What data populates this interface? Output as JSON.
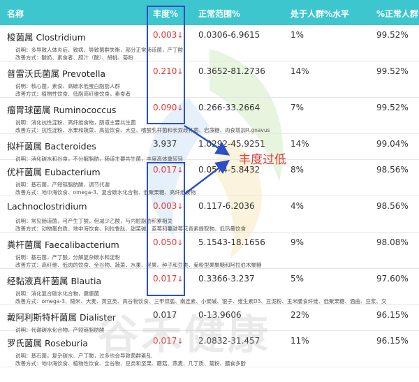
{
  "columns": {
    "name": "名称",
    "abundance": "丰度%",
    "normal_range": "正常范围%",
    "population_level": "处于人群%水平",
    "normal_population": "%正常人群"
  },
  "rows": [
    {
      "name": "梭菌属 Clostridium",
      "abundance": "0.003",
      "low": true,
      "range": "0.0306-6.9615",
      "pct": "1%",
      "norm": "99.52%",
      "desc": "说明：多导致人体炎症、致病，导致菌群失衡，部分正常肠道菌，产丁酸",
      "tips": "改善方式：酸奶、素食者、胆汁（酸）、胡桃、菊粉"
    },
    {
      "name": "普雷沃氏菌属 Prevotella",
      "abundance": "0.210",
      "low": true,
      "range": "0.3652-81.2736",
      "pct": "14%",
      "norm": "99.52%",
      "desc": "说明：核心菌，素食、高碳水低蛋白脂肪人群",
      "tips": "改善方式：植物性饮食、低脂高纤维饮食，素食者"
    },
    {
      "name": "瘤胃球菌属 Ruminococcus",
      "abundance": "0.090",
      "low": true,
      "range": "0.266-33.2664",
      "pct": "7%",
      "norm": "99.52%",
      "desc": "说明：消化抗性淀粉、高纤维食物，肠道主要共生菌",
      "tips": "改善方式：抗性淀粉、水果和蔬菜、高盐饮食、大豆、嗜酸乳杆菌和长双歧杆菌、岩藻糖、肉食增加R.gnavus"
    },
    {
      "name": "拟杆菌属 Bacteroides",
      "abundance": "3.937",
      "low": false,
      "range": "1.0292-45.9251",
      "pct": "14%",
      "norm": "99.04%",
      "desc": "说明：消化碳水和谷食，不分解脂肪，肠道主要共生菌，丰度高体重较轻",
      "tips": ""
    },
    {
      "name": "优杆菌属 Eubacterium",
      "abundance": "0.017",
      "low": true,
      "range": "0.0574-5.8432",
      "pct": "8%",
      "norm": "98.56%",
      "desc": "说明：基石菌，产短链脂肪酸，调节代谢",
      "tips": "改善方式：地中海饮食、omega-3、复合碳水化合物、低聚果糖、高纤维食物"
    },
    {
      "name": "Lachnoclostridium",
      "abundance": "0.003",
      "low": true,
      "range": "0.117-6.2036",
      "pct": "4%",
      "norm": "98.56%",
      "desc": "说明：常见肠道菌，可产生丁酸，但减少乙酸，与内脏脂肪积累相关",
      "tips": "改善方式：动物蛋白质、地中海饮食、利拉鲁肽、甜菜碱、蓝莓和蔓越莓花青素提取物、低热量饮食"
    },
    {
      "name": "粪杆菌属 Faecalibacterium",
      "abundance": "0.050",
      "low": true,
      "range": "5.1543-18.1656",
      "pct": "9%",
      "norm": "98.08%",
      "desc": "说明：基石菌，产丁酸，分解复杂碳水和淀粉",
      "tips": "改善方式：高纤维、低肉的饮食、全谷物、蔬菜、水果、坚果、种子和豆类、菊粉型果聚糖和阿拉伯木聚糖"
    },
    {
      "name": "经黏液真杆菌属 Blautia",
      "abundance": "0.017",
      "low": true,
      "range": "0.3366-3.237",
      "pct": "5%",
      "norm": "97.60%",
      "desc": "说明：消化复合碳水化合物，健康菌",
      "tips": "改善方式：omega-3、糙米、大麦、黄豆类、高谷物饮食、三甲双胍、南连素、小檗碱、银子、维生素D3、豆泥粉、玉米膳食纤维、低聚果糖、酒曲、豆浆、交"
    },
    {
      "name": "戴阿利斯特杆菌属 Dialister",
      "abundance": "0.017",
      "low": false,
      "range": "0-13.9606",
      "pct": "22%",
      "norm": "96.15%",
      "desc": "说明：代谢碳水化合物、产短链脂肪酸",
      "tips": ""
    },
    {
      "name": "罗氏菌属 Roseburia",
      "abundance": "0.017",
      "low": true,
      "range": "2.0832-31.457",
      "pct": "11%",
      "norm": "96.15%",
      "desc": "说明：基石菌，复杂碳水、产丁酸，过多也会导致菌群紊乱",
      "tips": "改善方式：地中海饮食、植物性饮食、全谷物、豆类和坚果、蘑菇、燕麦、几丁质、菊粉、膳食多酚"
    }
  ],
  "low_arrow": "↓",
  "callout_text": "丰度过低",
  "watermark": "谷禾健康",
  "colors": {
    "header": "#3ec6cf",
    "low": "#e53935",
    "highlight": "#2a4fc8"
  }
}
